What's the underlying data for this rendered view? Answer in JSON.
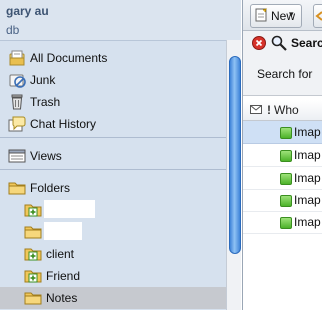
{
  "account": {
    "name": "gary au",
    "subtitle": "db"
  },
  "sidebar": {
    "items": [
      {
        "label": "All Documents",
        "icon": "documents-icon"
      },
      {
        "label": "Junk",
        "icon": "junk-icon"
      },
      {
        "label": "Trash",
        "icon": "trash-icon"
      },
      {
        "label": "Chat History",
        "icon": "chat-history-icon"
      }
    ],
    "views": {
      "label": "Views",
      "icon": "views-icon"
    },
    "folders": {
      "label": "Folders",
      "icon": "folders-icon",
      "children": [
        {
          "label": "",
          "icon": "folder-plus-icon"
        },
        {
          "label": "",
          "icon": "folder-icon"
        },
        {
          "label": "client",
          "icon": "folder-plus-icon"
        },
        {
          "label": "Friend",
          "icon": "folder-plus-icon"
        },
        {
          "label": "Notes",
          "icon": "folder-icon",
          "selected": true
        }
      ]
    }
  },
  "toolbar": {
    "new_label": "New"
  },
  "search": {
    "title": "Search",
    "for_label": "Search for"
  },
  "message_list": {
    "columns": {
      "who": "Who"
    },
    "rows": [
      {
        "label": "Imap",
        "selected": true
      },
      {
        "label": "Imap"
      },
      {
        "label": "Imap"
      },
      {
        "label": "Imap"
      },
      {
        "label": "Imap"
      }
    ]
  },
  "colors": {
    "accent": "#3f84d9",
    "selection": "#c6c9cf",
    "sidebar_bg": "#d6e1ee"
  }
}
